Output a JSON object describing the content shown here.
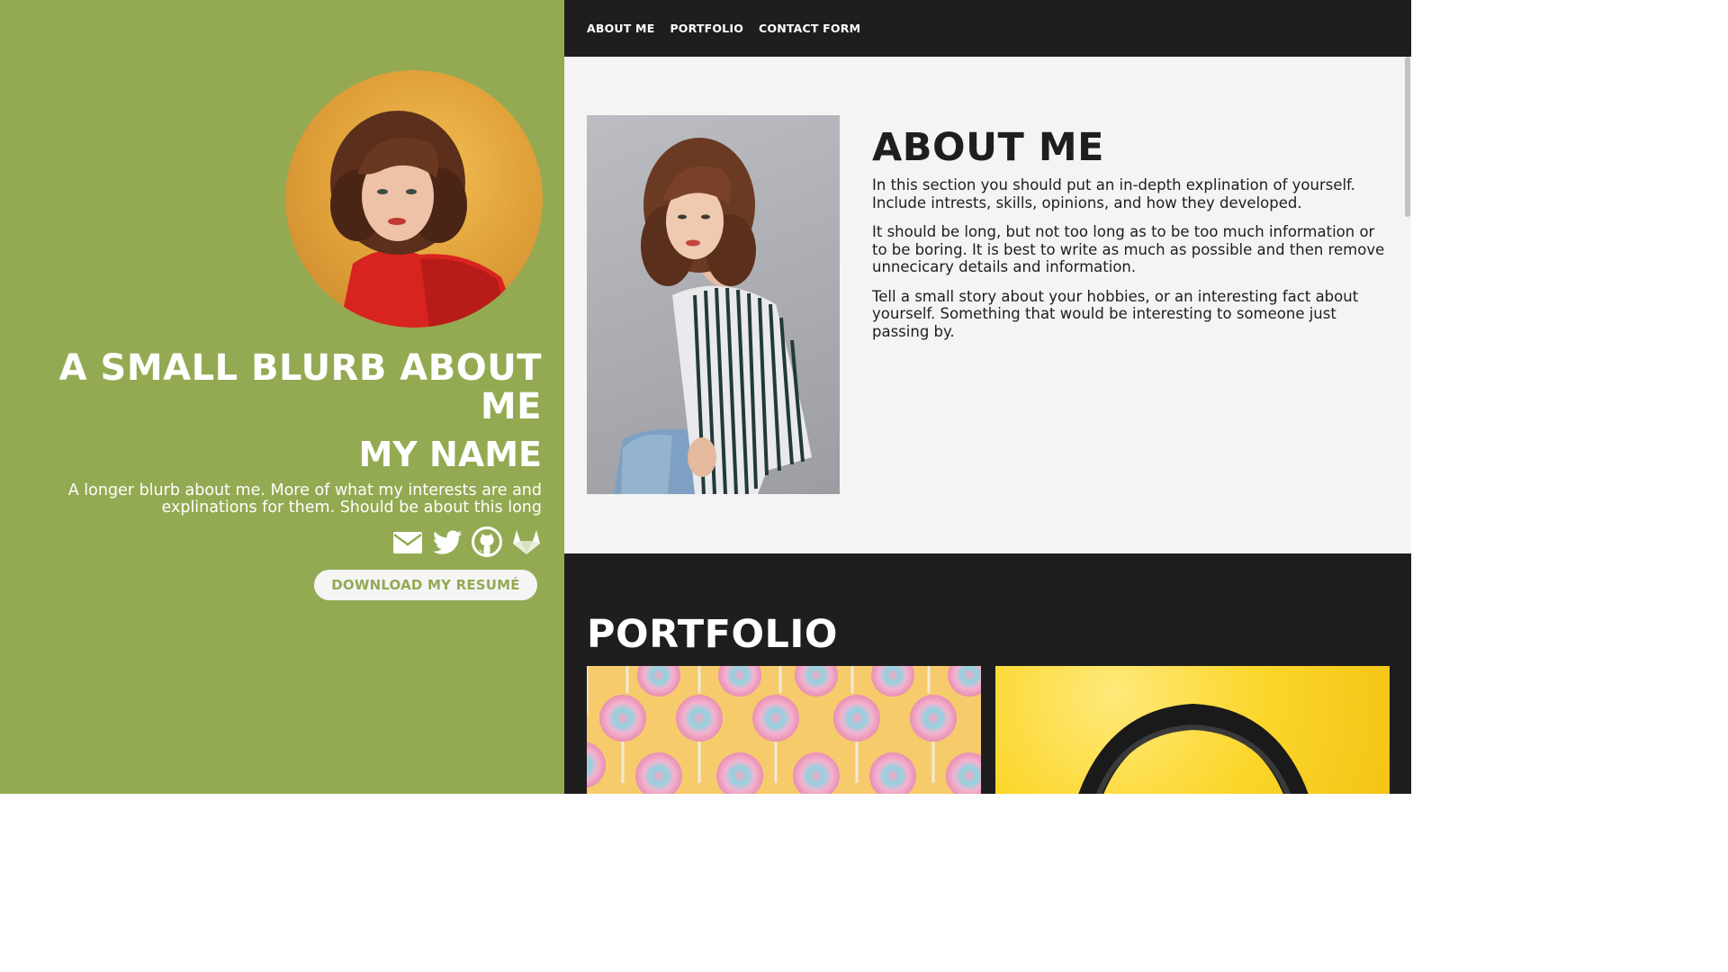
{
  "sidebar": {
    "blurb_title": "A SMALL BLURB ABOUT ME",
    "name": "MY NAME",
    "blurb_long": "A longer blurb about me. More of what my interests are and explinations for them. Should be about this long",
    "social_icons": [
      "email-icon",
      "twitter-icon",
      "github-icon",
      "gitlab-icon"
    ],
    "resume_button": "DOWNLOAD MY RESUMÉ",
    "bg_color": "#93aa52"
  },
  "nav": {
    "items": [
      "ABOUT ME",
      "PORTFOLIO",
      "CONTACT FORM"
    ]
  },
  "about": {
    "title": "ABOUT ME",
    "paragraphs": [
      "In this section you should put an in-depth explination of yourself. Include intrests, skills, opinions, and how they developed.",
      "It should be long, but not too long as to be too much information or to be boring. It is best to write as much as possible and then remove unnecicary details and information.",
      "Tell a small story about your hobbies, or an interesting fact about yourself. Something that would be interesting to someone just passing by."
    ]
  },
  "portfolio": {
    "title": "PORTFOLIO",
    "bg_color": "#1e1e1e"
  }
}
